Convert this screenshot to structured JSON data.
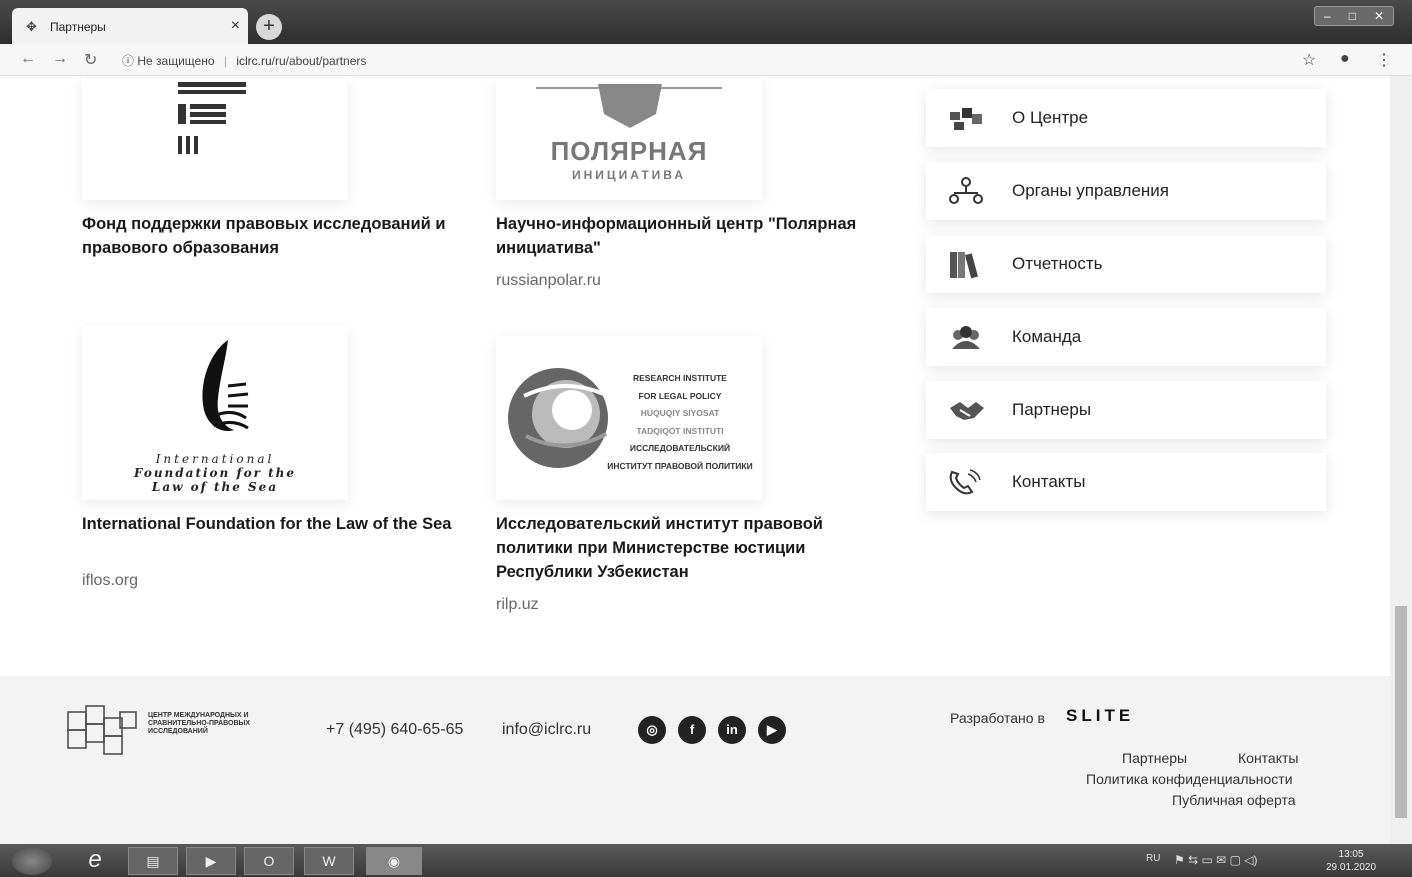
{
  "browser": {
    "tab_title": "Партнеры",
    "tab_close": "×",
    "new_tab": "+",
    "security_label": "Не защищено",
    "url_host": "iclrc.ru",
    "url_path": "/ru/about/partners"
  },
  "partners": [
    {
      "name": "Фонд поддержки правовых исследований и правового образования",
      "link": ""
    },
    {
      "name": "Научно-информационный центр \"Полярная инициатива\"",
      "link": "russianpolar.ru",
      "logo_text": "ПОЛЯРНАЯ",
      "logo_subtext": "ИНИЦИАТИВА"
    },
    {
      "name": "International Foundation for the Law of the Sea",
      "link": "iflos.org",
      "logo_lines": [
        "International",
        "Foundation for the",
        "Law of the Sea"
      ]
    },
    {
      "name": "Исследовательский институт правовой политики при Министерстве юстиции Республики Узбекистан",
      "link": "rilp.uz",
      "logo_lines": [
        "RESEARCH INSTITUTE",
        "FOR LEGAL POLICY",
        "HUQUQIY SIYOSAT",
        "TADQIQOT INSTITUTI",
        "ИССЛЕДОВАТЕЛЬСКИЙ",
        "ИНСТИТУТ ПРАВОВОЙ ПОЛИТИКИ"
      ]
    }
  ],
  "sidebar_menu": [
    {
      "label": "О Центре",
      "icon": "center-icon"
    },
    {
      "label": "Органы управления",
      "icon": "management-icon"
    },
    {
      "label": "Отчетность",
      "icon": "books-icon"
    },
    {
      "label": "Команда",
      "icon": "team-icon"
    },
    {
      "label": "Партнеры",
      "icon": "handshake-icon"
    },
    {
      "label": "Контакты",
      "icon": "phone-icon"
    }
  ],
  "footer": {
    "logo_text": "ЦЕНТР МЕЖДУНАРОДНЫХ И СРАВНИТЕЛЬНО-ПРАВОВЫХ ИССЛЕДОВАНИЙ",
    "phone": "+7 (495) 640-65-65",
    "email": "info@iclrc.ru",
    "developed_by": "Разработано в",
    "developer": "SLITE",
    "links": {
      "partners": "Партнеры",
      "contacts": "Контакты",
      "privacy": "Политика конфиденциальности",
      "offer": "Публичная оферта"
    }
  },
  "taskbar": {
    "lang": "RU",
    "time": "13:05",
    "date": "29.01.2020"
  }
}
